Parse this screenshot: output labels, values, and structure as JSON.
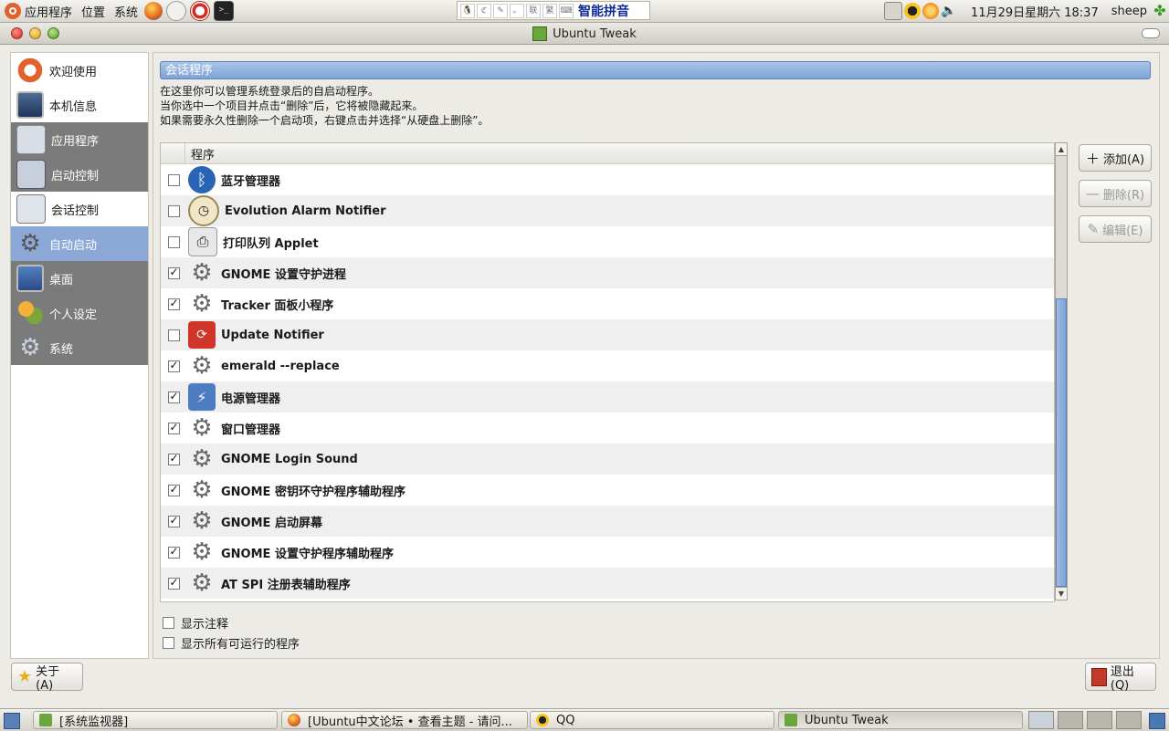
{
  "top_panel": {
    "menus": [
      "应用程序",
      "位置",
      "系统"
    ],
    "ime_label": "智能拼音",
    "clock": "11月29日星期六  18:37",
    "user": "sheep"
  },
  "window": {
    "title": "Ubuntu Tweak"
  },
  "sidebar": {
    "items": [
      {
        "label": "欢迎使用"
      },
      {
        "label": "本机信息"
      },
      {
        "label": "应用程序"
      },
      {
        "label": "启动控制"
      },
      {
        "label": "会话控制"
      },
      {
        "label": "自动启动"
      },
      {
        "label": "桌面"
      },
      {
        "label": "个人设定"
      },
      {
        "label": "系统"
      }
    ]
  },
  "main": {
    "section_title": "会话程序",
    "desc_lines": [
      "在这里你可以管理系统登录后的自启动程序。",
      "当你选中一个项目并点击“删除”后，它将被隐藏起来。",
      "如果需要永久性删除一个启动项，右键点击并选择“从硬盘上删除”。"
    ],
    "column_header": "程序",
    "rows": [
      {
        "label": "蓝牙管理器",
        "checked": false
      },
      {
        "label": "Evolution Alarm Notifier",
        "checked": false
      },
      {
        "label": "打印队列 Applet",
        "checked": false
      },
      {
        "label": "GNOME 设置守护进程",
        "checked": true
      },
      {
        "label": "Tracker 面板小程序",
        "checked": true
      },
      {
        "label": "Update Notifier",
        "checked": false
      },
      {
        "label": "emerald --replace",
        "checked": true
      },
      {
        "label": "电源管理器",
        "checked": true
      },
      {
        "label": "窗口管理器",
        "checked": true
      },
      {
        "label": "GNOME Login Sound",
        "checked": true
      },
      {
        "label": "GNOME 密钥环守护程序辅助程序",
        "checked": true
      },
      {
        "label": "GNOME 启动屏幕",
        "checked": true
      },
      {
        "label": "GNOME 设置守护程序辅助程序",
        "checked": true
      },
      {
        "label": "AT SPI 注册表辅助程序",
        "checked": true
      }
    ],
    "buttons": {
      "add": "添加(A)",
      "remove": "删除(R)",
      "edit": "编辑(E)"
    },
    "options": {
      "show_comments": "显示注释",
      "show_all": "显示所有可运行的程序"
    }
  },
  "footer": {
    "about": "关于(A)",
    "quit": "退出(Q)"
  },
  "taskbar": {
    "tasks": [
      "[系统监视器]",
      "[Ubuntu中文论坛 • 查看主题 - 请问...",
      "QQ",
      "Ubuntu Tweak"
    ]
  }
}
